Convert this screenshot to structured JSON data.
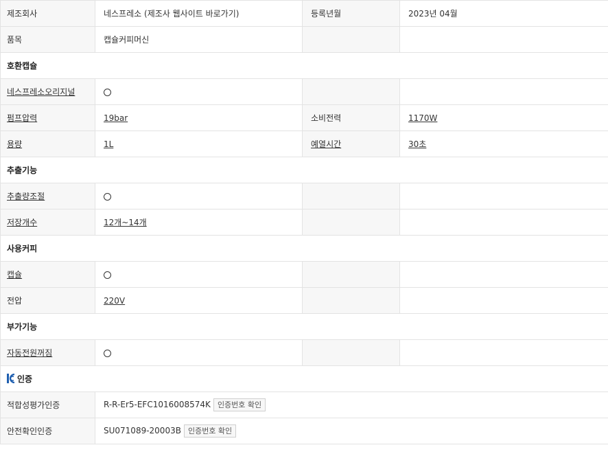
{
  "rows": {
    "r0": {
      "l1": "제조회사",
      "v1": "네스프레소 (제조사 웹사이트 바로가기)",
      "l2": "등록년월",
      "v2": "2023년 04월"
    },
    "r1": {
      "l1": "품목",
      "v1": "캡슐커피머신"
    },
    "s_compat": "호환캡슐",
    "r2": {
      "l1": "네스프레소오리지널",
      "v1_icon": "circle-mark"
    },
    "r3": {
      "l1": "펌프압력",
      "v1": "19bar",
      "l2": "소비전력",
      "v2": "1170W"
    },
    "r4": {
      "l1": "용량",
      "v1": "1L",
      "l2": "예열시간",
      "v2": "30초"
    },
    "s_extract": "추출기능",
    "r5": {
      "l1": "추출량조절",
      "v1_icon": "circle-mark"
    },
    "r6": {
      "l1": "저장개수",
      "v1": "12개~14개"
    },
    "s_coffee": "사용커피",
    "r7": {
      "l1": "캡슐",
      "v1_icon": "circle-mark"
    },
    "r8": {
      "l1": "전압",
      "v1": "220V"
    },
    "s_extra": "부가기능",
    "r9": {
      "l1": "자동전원꺼짐",
      "v1_icon": "circle-mark"
    },
    "s_cert": "인증",
    "r10": {
      "l1": "적합성평가인증",
      "v1": "R-R-Er5-EFC1016008574K",
      "btn": "인증번호 확인"
    },
    "r11": {
      "l1": "안전확인인증",
      "v1": "SU071089-20003B",
      "btn": "인증번호 확인"
    }
  },
  "colors": {
    "label_bg": "#f7f7f7",
    "border": "#e3e3e3",
    "kc_blue": "#1f5fb0"
  }
}
